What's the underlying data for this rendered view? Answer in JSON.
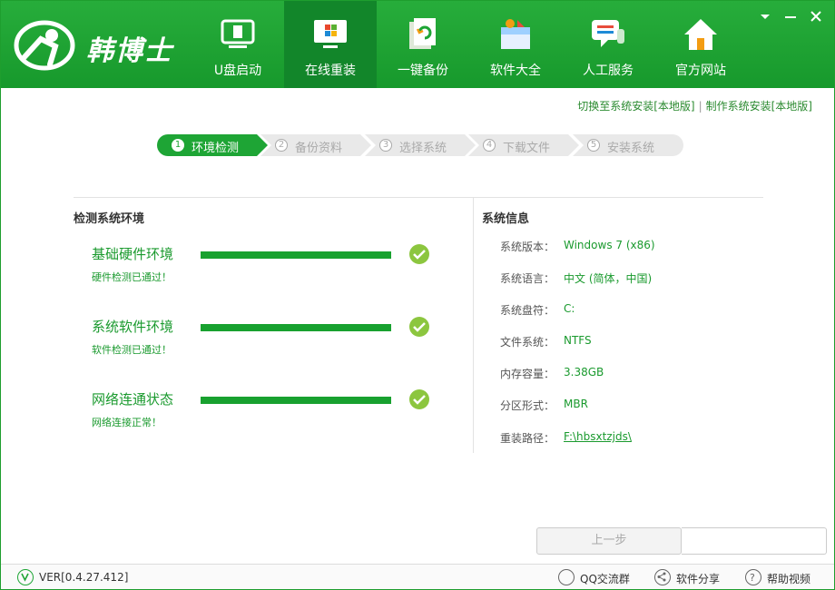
{
  "app": {
    "brand": "韩博士"
  },
  "nav": [
    {
      "label": "U盘启动",
      "icon": "usb-disk-icon"
    },
    {
      "label": "在线重装",
      "icon": "monitor-windows-icon"
    },
    {
      "label": "一键备份",
      "icon": "backup-document-icon"
    },
    {
      "label": "软件大全",
      "icon": "software-box-icon"
    },
    {
      "label": "人工服务",
      "icon": "chat-support-icon"
    },
    {
      "label": "官方网站",
      "icon": "home-icon"
    }
  ],
  "mode_links": {
    "local": "切换至系统安装[本地版]",
    "separator": "|",
    "make": "制作系统安装[本地版]"
  },
  "steps": [
    {
      "num": "1",
      "label": "环境检测"
    },
    {
      "num": "2",
      "label": "备份资料"
    },
    {
      "num": "3",
      "label": "选择系统"
    },
    {
      "num": "4",
      "label": "下载文件"
    },
    {
      "num": "5",
      "label": "安装系统"
    }
  ],
  "detect": {
    "title": "检测系统环境",
    "items": [
      {
        "title": "基础硬件环境",
        "status": "硬件检测已通过！",
        "progress": 1.0
      },
      {
        "title": "系统软件环境",
        "status": "软件检测已通过！",
        "progress": 1.0
      },
      {
        "title": "网络连通状态",
        "status": "网络连接正常！",
        "progress": 1.0
      }
    ]
  },
  "sysinfo": {
    "title": "系统信息",
    "rows": [
      {
        "key": "系统版本：",
        "value": "Windows 7 (x86)"
      },
      {
        "key": "系统语言：",
        "value": "中文 (简体，中国)"
      },
      {
        "key": "系统盘符：",
        "value": "C:"
      },
      {
        "key": "文件系统：",
        "value": "NTFS"
      },
      {
        "key": "内存容量：",
        "value": "3.38GB"
      },
      {
        "key": "分区形式：",
        "value": "MBR"
      },
      {
        "key": "重装路径：",
        "value": "F:\\hbsxtzjds\\"
      }
    ]
  },
  "buttons": {
    "prev": "上一步"
  },
  "footer": {
    "version": "VER[0.4.27.412]",
    "qq": "QQ交流群",
    "share": "软件分享",
    "help": "帮助视频"
  },
  "colors": {
    "brand_green": "#1ea535",
    "text_green": "#1a9a2e",
    "check_green": "#8cc63f"
  }
}
